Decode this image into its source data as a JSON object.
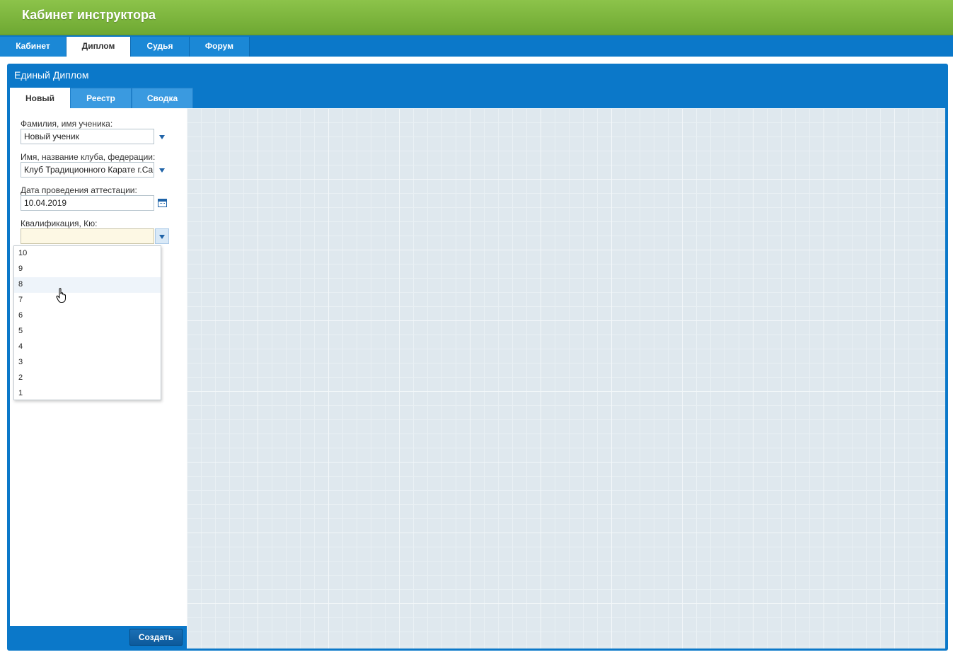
{
  "header": {
    "title": "Кабинет инструктора"
  },
  "top_nav": {
    "tabs": [
      {
        "label": "Кабинет",
        "active": false
      },
      {
        "label": "Диплом",
        "active": true
      },
      {
        "label": "Судья",
        "active": false
      },
      {
        "label": "Форум",
        "active": false
      }
    ]
  },
  "panel": {
    "title": "Единый Диплом",
    "tabs": [
      {
        "label": "Новый",
        "active": true
      },
      {
        "label": "Реестр",
        "active": false
      },
      {
        "label": "Сводка",
        "active": false
      }
    ]
  },
  "form": {
    "student": {
      "label": "Фамилия, имя ученика:",
      "value": "Новый ученик"
    },
    "club": {
      "label": "Имя, название клуба, федерации:",
      "value": "Клуб Традиционного Карате г.Са"
    },
    "date": {
      "label": "Дата проведения аттестации:",
      "value": "10.04.2019"
    },
    "qualification": {
      "label": "Квалификация, Кю:",
      "value": "",
      "options": [
        "10",
        "9",
        "8",
        "7",
        "6",
        "5",
        "4",
        "3",
        "2",
        "1"
      ],
      "hovered": "8"
    }
  },
  "footer": {
    "create_label": "Создать"
  },
  "colors": {
    "header": "#8cc34a",
    "nav": "#0b78c9",
    "accent": "#1f63a8"
  }
}
